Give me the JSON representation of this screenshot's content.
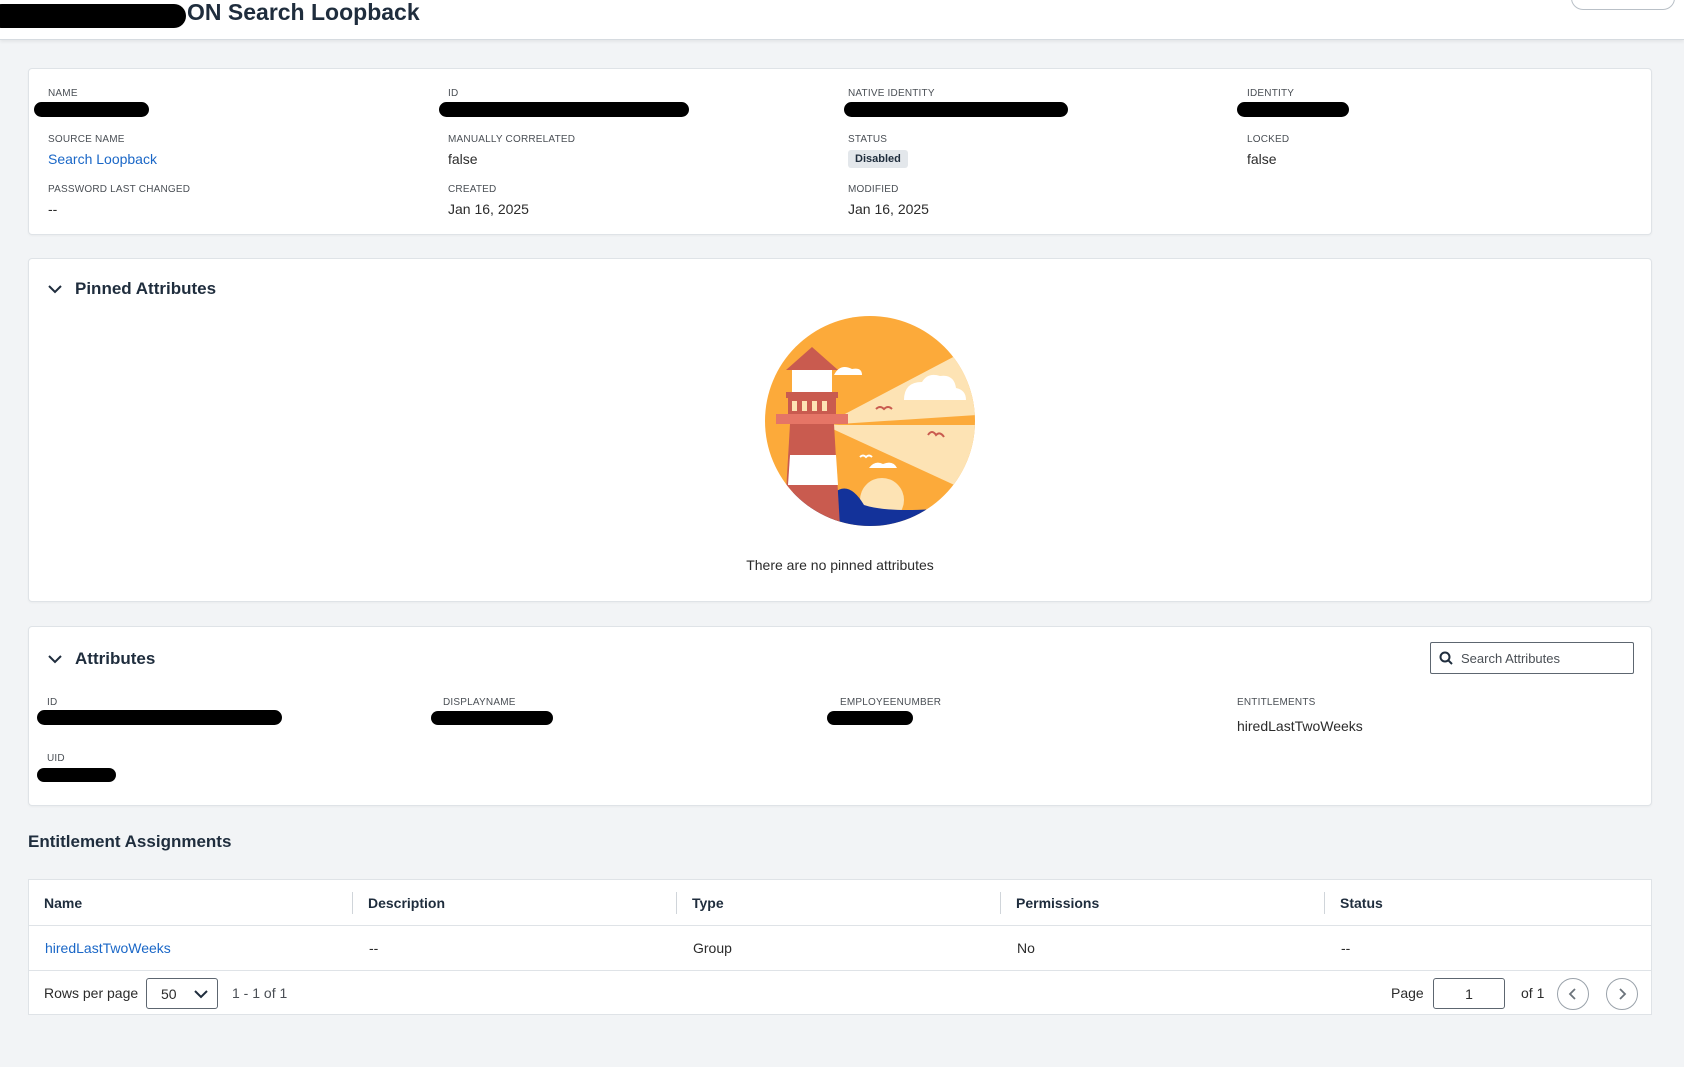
{
  "header": {
    "title": "ON Search Loopback"
  },
  "details": {
    "name_label": "NAME",
    "id_label": "ID",
    "native_identity_label": "NATIVE IDENTITY",
    "identity_label": "IDENTITY",
    "source_name_label": "SOURCE NAME",
    "source_name_value": "Search Loopback",
    "manually_correlated_label": "MANUALLY CORRELATED",
    "manually_correlated_value": "false",
    "status_label": "STATUS",
    "status_value": "Disabled",
    "locked_label": "LOCKED",
    "locked_value": "false",
    "password_last_changed_label": "PASSWORD LAST CHANGED",
    "password_last_changed_value": "--",
    "created_label": "CREATED",
    "created_value": "Jan 16, 2025",
    "modified_label": "MODIFIED",
    "modified_value": "Jan 16, 2025"
  },
  "pinned": {
    "title": "Pinned Attributes",
    "empty_text": "There are no pinned attributes",
    "illustration_icon": "lighthouse-illustration"
  },
  "attributes": {
    "title": "Attributes",
    "search_placeholder": "Search Attributes",
    "items": [
      {
        "label": "id",
        "value": ""
      },
      {
        "label": "displayName",
        "value": ""
      },
      {
        "label": "employeeNumber",
        "value": ""
      },
      {
        "label": "entitlements",
        "value": "hiredLastTwoWeeks"
      },
      {
        "label": "uid",
        "value": ""
      }
    ]
  },
  "entitlements": {
    "title": "Entitlement Assignments",
    "columns": [
      "Name",
      "Description",
      "Type",
      "Permissions",
      "Status"
    ],
    "rows": [
      {
        "name": "hiredLastTwoWeeks",
        "description": "--",
        "type": "Group",
        "permissions": "No",
        "status": "--"
      }
    ],
    "footer": {
      "rows_per_page_label": "Rows per page",
      "rows_per_page_value": "50",
      "range_text": "1 - 1 of 1",
      "page_label": "Page",
      "page_value": "1",
      "of_text": "of 1"
    }
  },
  "colors": {
    "link": "#1a67c7",
    "heading": "#1f2d3d",
    "background": "#f2f4f6",
    "badge_bg": "#e3e7eb"
  }
}
